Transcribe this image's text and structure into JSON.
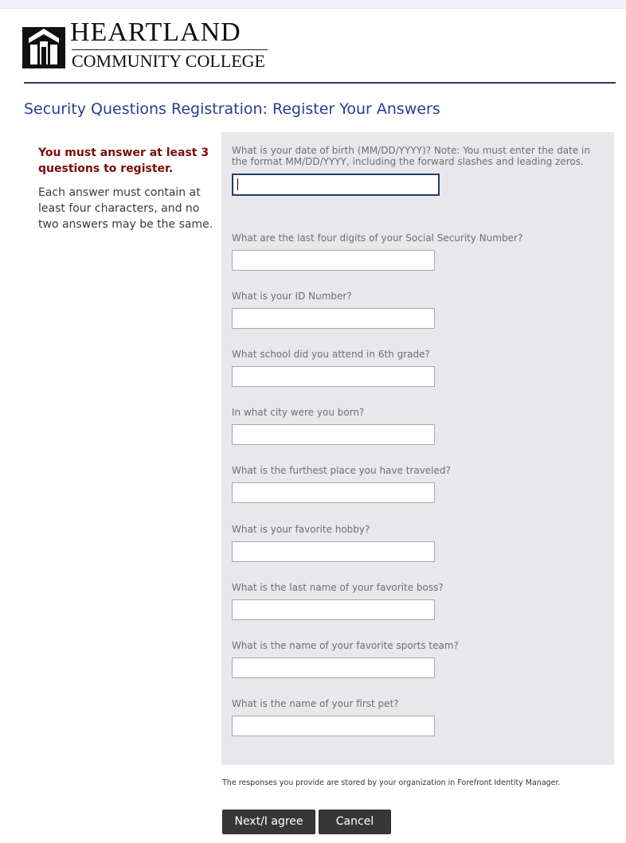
{
  "header": {
    "logo_title": "HEARTLAND",
    "logo_subtitle": "COMMUNITY COLLEGE"
  },
  "page": {
    "title": "Security Questions Registration:  Register Your Answers"
  },
  "instructions": {
    "requirement": "You must answer at least 3 questions to register.",
    "rule": "Each answer must contain at least four characters, and no two answers may be the same."
  },
  "questions": [
    {
      "label": "What is your date of birth (MM/DD/YYYY)? Note: You must enter the date in the format MM/DD/YYYY, including the forward slashes and leading zeros.",
      "value": ""
    },
    {
      "label": "What are the last four digits of your Social Security Number?",
      "value": ""
    },
    {
      "label": "What is your ID Number?",
      "value": ""
    },
    {
      "label": "What school did you attend in 6th grade?",
      "value": ""
    },
    {
      "label": "In what city were you born?",
      "value": ""
    },
    {
      "label": "What is the furthest place you have traveled?",
      "value": ""
    },
    {
      "label": "What is your favorite hobby?",
      "value": ""
    },
    {
      "label": "What is the last name of your favorite boss?",
      "value": ""
    },
    {
      "label": "What is the name of your favorite sports team?",
      "value": ""
    },
    {
      "label": "What is the name of your first pet?",
      "value": ""
    }
  ],
  "footer": {
    "note": "The responses you provide are stored by your organization in Forefront Identity Manager."
  },
  "buttons": {
    "next_label": "Next/I agree",
    "cancel_label": "Cancel"
  },
  "colors": {
    "title_blue": "#243f8d",
    "requirement_red": "#7d0b0b",
    "panel_gray": "#e8e8ec",
    "button_dark": "#373737",
    "header_rule": "#2f3a6d"
  },
  "icons": {
    "logo": "heartland-building-logo-icon"
  }
}
